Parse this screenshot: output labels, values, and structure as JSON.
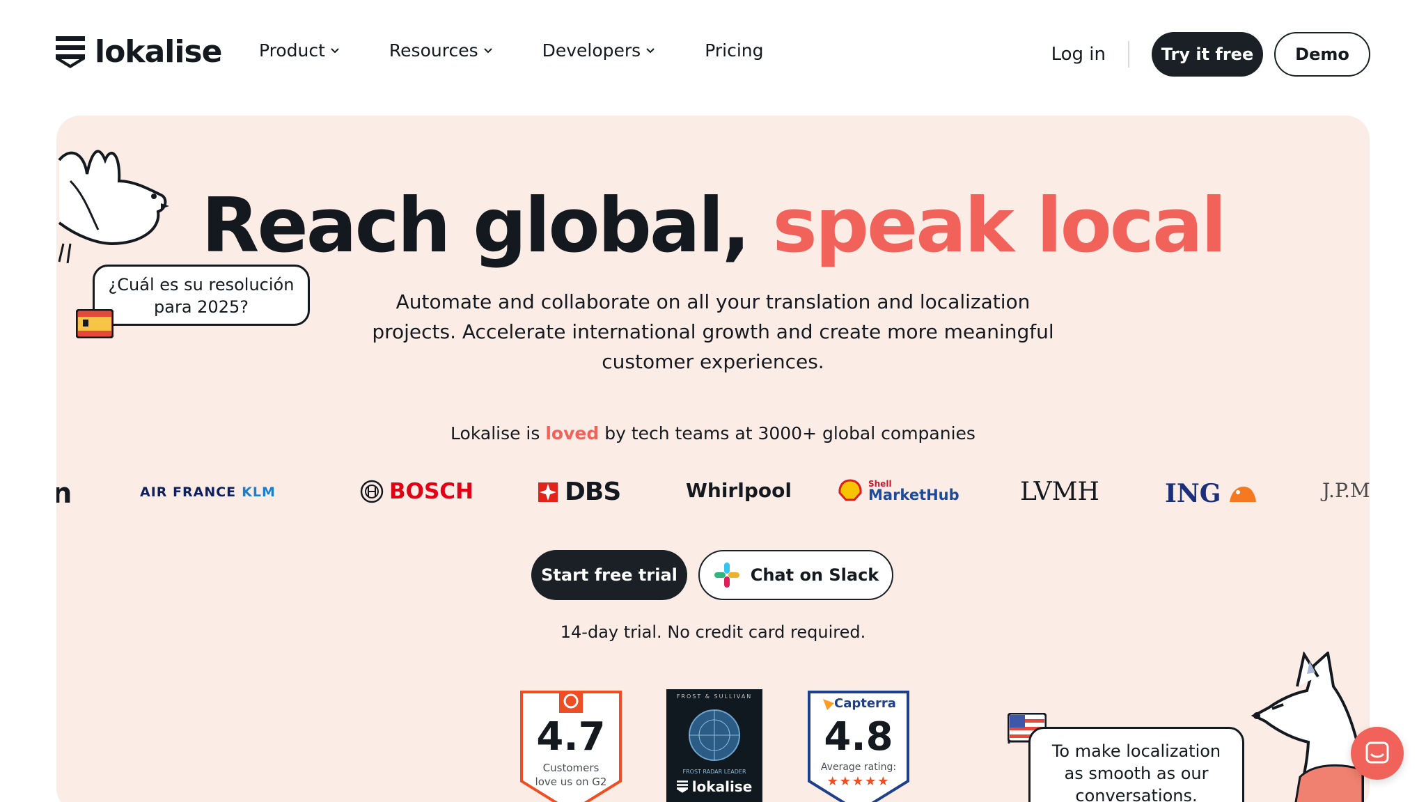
{
  "header": {
    "logo_text": "lokalise",
    "nav": [
      {
        "label": "Product",
        "has_dropdown": true
      },
      {
        "label": "Resources",
        "has_dropdown": true
      },
      {
        "label": "Developers",
        "has_dropdown": true
      },
      {
        "label": "Pricing",
        "has_dropdown": false
      }
    ],
    "login_label": "Log in",
    "try_label": "Try it free",
    "demo_label": "Demo"
  },
  "hero": {
    "headline_main": "Reach global, ",
    "headline_accent": "speak local",
    "subtitle": "Automate and collaborate on all your translation and localization projects. Accelerate international growth and create more meaningful customer experiences.",
    "loved_prefix": "Lokalise is ",
    "loved_word": "loved",
    "loved_suffix": " by tech teams at 3000+ global companies",
    "logos": {
      "first_partial": "n",
      "airfrance": "AIR FRANCE",
      "klm": "KLM",
      "bosch": "BOSCH",
      "dbs": "DBS",
      "whirlpool": "Whirlpool",
      "shell_small": "Shell",
      "shell_text": "MarketHub",
      "lvmh": "LVMH",
      "ing": "ING",
      "jpm": "J.P.M"
    },
    "start_trial_label": "Start free trial",
    "slack_label": "Chat on Slack",
    "trial_note": "14-day trial. No credit card required.",
    "badges": {
      "g2_rating": "4.7",
      "g2_caption_1": "Customers",
      "g2_caption_2": "love us on G2",
      "frost_top": "FROST & SULLIVAN",
      "frost_leader": "FROST RADAR LEADER",
      "frost_logo": "lokalise",
      "capterra_name": "Capterra",
      "capterra_rating": "4.8",
      "capterra_caption": "Average rating:"
    },
    "bubble_es_line1": "¿Cuál es su resolución",
    "bubble_es_line2": "para 2025?",
    "bubble_en_line1": "To make localization",
    "bubble_en_line2": "as smooth as our",
    "bubble_en_line3": "conversations."
  },
  "colors": {
    "accent": "#f0625a",
    "dark": "#1b2026",
    "hero_bg": "#fcece6"
  }
}
